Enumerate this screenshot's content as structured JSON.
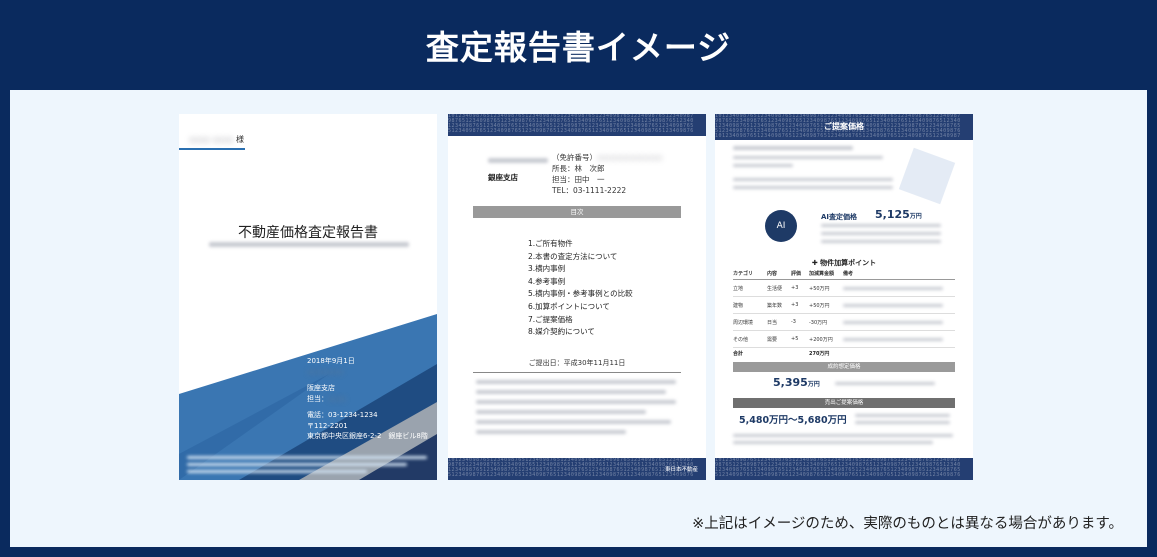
{
  "title": "査定報告書イメージ",
  "note": "※上記はイメージのため、実際のものとは異なる場合があります。",
  "cover": {
    "salutation": "様",
    "doc_title": "不動産価格査定報告書",
    "date": "2018年9月1日",
    "branch": "阪座支店",
    "staff_label": "担当：",
    "tel": "電話：03-1234-1234",
    "postal": "〒112-2201",
    "address": "東京都中央区銀座6-2-2　銀座ビル8階"
  },
  "toc": {
    "license": "（免許番号）",
    "manager": "所長：林　次郎",
    "staff": "担当：田中　一",
    "tel": "TEL：03-1111-2222",
    "branch": "銀座支店",
    "heading": "目次",
    "items": [
      "1.ご所有物件",
      "2.本書の査定方法について",
      "3.横内事例",
      "4.参考事例",
      "5.横内事例・参考事例との比較",
      "6.加算ポイントについて",
      "7.ご提案価格",
      "8.媒介契約について"
    ],
    "submit_date": "ご提出日：平成30年11月11日",
    "footer": "東日本不動産"
  },
  "proposal": {
    "heading": "ご提案価格",
    "ai_badge": "AI",
    "ai_label": "AI査定価格",
    "ai_price": "5,125",
    "unit": "万円",
    "add_title": "✚ 物件加算ポイント",
    "col_headers": [
      "カテゴリ",
      "内容",
      "評価",
      "加減算金額",
      "備考"
    ],
    "rows": [
      {
        "cat": "立地",
        "content": "生活便",
        "score": "+3",
        "amount": "+50万円"
      },
      {
        "cat": "建物",
        "content": "築年数",
        "score": "+3",
        "amount": "+50万円"
      },
      {
        "cat": "周辺環境",
        "content": "日当",
        "score": "-3",
        "amount": "-30万円"
      },
      {
        "cat": "その他",
        "content": "需要",
        "score": "+5",
        "amount": "+200万円"
      }
    ],
    "total_label": "合計",
    "total": "270万円",
    "contract_label": "成約想定価格",
    "contract_price": "5,395",
    "offer_label": "売出ご提案価格",
    "offer_price": "5,480万円〜5,680万円"
  }
}
